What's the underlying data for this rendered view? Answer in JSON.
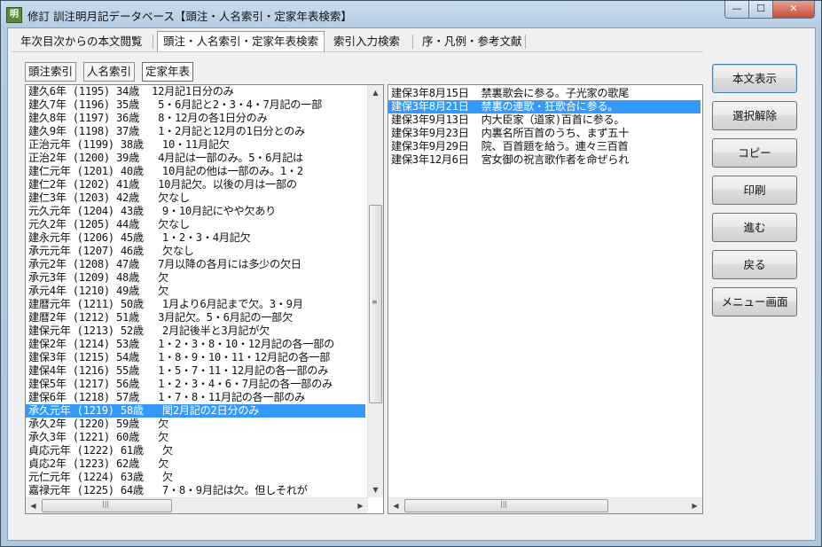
{
  "window": {
    "title": "修訂 訓注明月記データベース【頭注・人名索引・定家年表検索】",
    "app_icon": "app-icon",
    "minimize_glyph": "—",
    "maximize_glyph": "☐",
    "close_glyph": "✕"
  },
  "tabs": [
    {
      "label": "年次目次からの本文閲覧"
    },
    {
      "label": "頭注・人名索引・定家年表検索"
    },
    {
      "label": "索引入力検索"
    },
    {
      "label": "序・凡例・参考文献"
    }
  ],
  "subtabs": [
    {
      "label": "頭注索引"
    },
    {
      "label": "人名索引"
    },
    {
      "label": "定家年表"
    }
  ],
  "left_list": {
    "selected_index": 24,
    "rows": [
      "建久6年 (1195) 34歳  12月記1日分のみ",
      "建久7年 (1196) 35歳   5・6月記と2・3・4・7月記の一部",
      "建久8年 (1197) 36歳   8・12月の各1日分のみ",
      "建久9年 (1198) 37歳   1・2月記と12月の1日分とのみ",
      "正治元年 (1199) 38歳   10・11月記欠",
      "正治2年 (1200) 39歳   4月記は一部のみ。5・6月記は",
      "建仁元年 (1201) 40歳   10月記の他は一部のみ。1・2",
      "建仁2年 (1202) 41歳   10月記欠。以後の月は一部の",
      "建仁3年 (1203) 42歳   欠なし",
      "元久元年 (1204) 43歳   9・10月記にやや欠あり",
      "元久2年 (1205) 44歳   欠なし",
      "建永元年 (1206) 45歳   1・2・3・4月記欠",
      "承元元年 (1207) 46歳   欠なし",
      "承元2年 (1208) 47歳   7月以降の各月には多少の欠日",
      "承元3年 (1209) 48歳   欠",
      "承元4年 (1210) 49歳   欠",
      "建暦元年 (1211) 50歳   1月より6月記まで欠。3・9月",
      "建暦2年 (1212) 51歳   3月記欠。5・6月記の一部欠",
      "建保元年 (1213) 52歳   2月記後半と3月記が欠",
      "建保2年 (1214) 53歳   1・2・3・8・10・12月記の各一部の",
      "建保3年 (1215) 54歳   1・8・9・10・11・12月記の各一部",
      "建保4年 (1216) 55歳   1・5・7・11・12月記の各一部のみ",
      "建保5年 (1217) 56歳   1・2・3・4・6・7月記の各一部のみ",
      "建保6年 (1218) 57歳   1・7・8・11月記の各一部のみ",
      "承久元年 (1219) 58歳   閏2月記の2日分のみ",
      "承久2年 (1220) 59歳   欠",
      "承久3年 (1221) 60歳   欠",
      "貞応元年 (1222) 61歳   欠",
      "貞応2年 (1223) 62歳   欠",
      "元仁元年 (1224) 63歳   欠",
      "嘉禄元年 (1225) 64歳   7・8・9月記は欠。但しそれが"
    ]
  },
  "right_list": {
    "selected_index": 1,
    "rows": [
      "建保3年8月15日  禁裏歌会に参る。子光家の歌尾",
      "建保3年8月21日  禁裏の連歌・狂歌合に参る。",
      "建保3年9月13日  内大臣家（道家)百首に参る。",
      "建保3年9月23日  内裏名所百首のうち、まず五十",
      "建保3年9月29日  院、百首題を給う。連々三百首",
      "建保3年12月6日  宮女御の祝言歌作者を命ぜられ"
    ]
  },
  "buttons": {
    "show_text": "本文表示",
    "clear_selection": "選択解除",
    "copy": "コピー",
    "print": "印刷",
    "forward": "進む",
    "back": "戻る",
    "menu": "メニュー画面"
  }
}
